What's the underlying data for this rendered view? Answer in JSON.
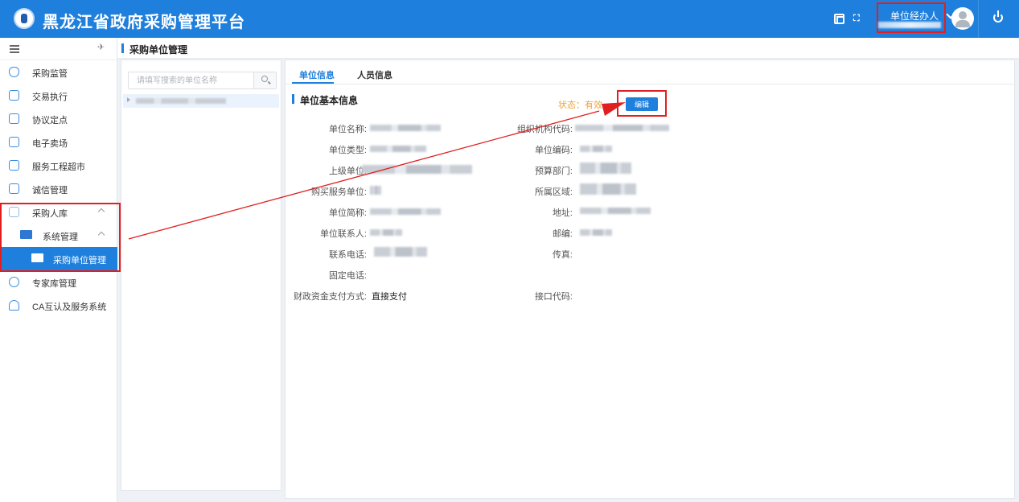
{
  "header": {
    "app_title": "黑龙江省政府采购管理平台",
    "user_role": "单位经办人",
    "icons": [
      "fullscreen-icon",
      "expand-icon",
      "avatar",
      "power-icon"
    ]
  },
  "sidebar": {
    "items": [
      {
        "label": "采购监管",
        "icon": "shield-icon"
      },
      {
        "label": "交易执行",
        "icon": "clipboard-icon"
      },
      {
        "label": "协议定点",
        "icon": "store-icon"
      },
      {
        "label": "电子卖场",
        "icon": "store-icon"
      },
      {
        "label": "服务工程超市",
        "icon": "store-icon"
      },
      {
        "label": "诚信管理",
        "icon": "card-icon"
      },
      {
        "label": "采购人库",
        "icon": "box-icon"
      },
      {
        "label": "系统管理",
        "icon": "monitor-icon"
      },
      {
        "label": "采购单位管理",
        "icon": "monitor-icon"
      },
      {
        "label": "专家库管理",
        "icon": "gear-icon"
      },
      {
        "label": "CA互认及服务系统",
        "icon": "user-icon"
      }
    ]
  },
  "breadcrumb": {
    "title": "采购单位管理"
  },
  "tree": {
    "search_placeholder": "请填写搜索的单位名称"
  },
  "main": {
    "tabs": [
      {
        "label": "单位信息"
      },
      {
        "label": "人员信息"
      }
    ],
    "section_title": "单位基本信息",
    "status_label": "状态：有效",
    "edit_button": "编辑",
    "fields": {
      "unit_name": "单位名称:",
      "org_code": "组织机构代码:",
      "unit_type": "单位类型:",
      "unit_code": "单位编码:",
      "parent_unit": "上级单位:",
      "budget_dept": "预算部门:",
      "purchase_service_unit": "购买服务单位:",
      "region": "所属区域:",
      "short_name": "单位简称:",
      "address": "地址:",
      "contact": "单位联系人:",
      "postcode": "邮编:",
      "phone": "联系电话:",
      "fax": "传真:",
      "landline": "固定电话:",
      "payment_method": "财政资金支付方式:",
      "payment_method_value": "直接支付",
      "interface_code": "接口代码:"
    }
  },
  "colors": {
    "brand": "#1f7fdc",
    "status": "#f0a23a",
    "annotation": "#e02020"
  }
}
